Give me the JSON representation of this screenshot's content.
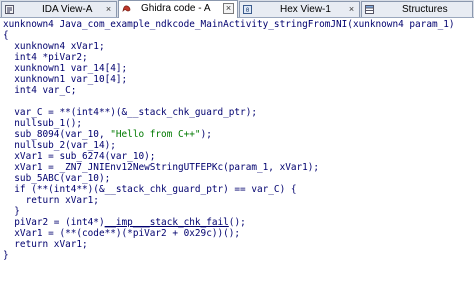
{
  "tabs": [
    {
      "label": "IDA View-A",
      "icon": "ida-view-icon",
      "active": false
    },
    {
      "label": "Ghidra code - A",
      "icon": "ghidra-icon",
      "active": true
    },
    {
      "label": "Hex View-1",
      "icon": "hex-view-icon",
      "active": false
    },
    {
      "label": "Structures",
      "icon": "structures-icon",
      "active": false
    }
  ],
  "close_glyph": "×",
  "code": {
    "l1": "xunknown4 Java_com_example_ndkcode_MainActivity_stringFromJNI(xunknown4 param_1)",
    "l2": "{",
    "l3": "  xunknown4 xVar1;",
    "l4": "  int4 *piVar2;",
    "l5": "  xunknown1 var_14[4];",
    "l6": "  xunknown1 var_10[4];",
    "l7": "  int4 var_C;",
    "l8": "",
    "l9": "  var_C = **(int4**)(&__stack_chk_guard_ptr);",
    "l10": "  nullsub_1();",
    "l11a": "  sub_8094(var_10, ",
    "l11b": "\"Hello from C++\"",
    "l11c": ");",
    "l12": "  nullsub_2(var_14);",
    "l13": "  xVar1 = sub_6274(var_10);",
    "l14": "  xVar1 = _ZN7_JNIEnv12NewStringUTFEPKc(param_1, xVar1);",
    "l15": "  sub_5ABC(var_10);",
    "l16": "  if (**(int4**)(&__stack_chk_guard_ptr) == var_C) {",
    "l17": "    return xVar1;",
    "l18": "  }",
    "l19a": "  piVar2 = (int4*)",
    "l19b": "__imp___stack_chk_fail",
    "l19c": "();",
    "l20": "  xVar1 = (**(code**)(*piVar2 + 0x29c))();",
    "l21": "  return xVar1;",
    "l22": "}"
  },
  "colors": {
    "code_text": "#00006e",
    "string_literal": "#007a00",
    "tabbar_bg": "#d9dee7"
  }
}
